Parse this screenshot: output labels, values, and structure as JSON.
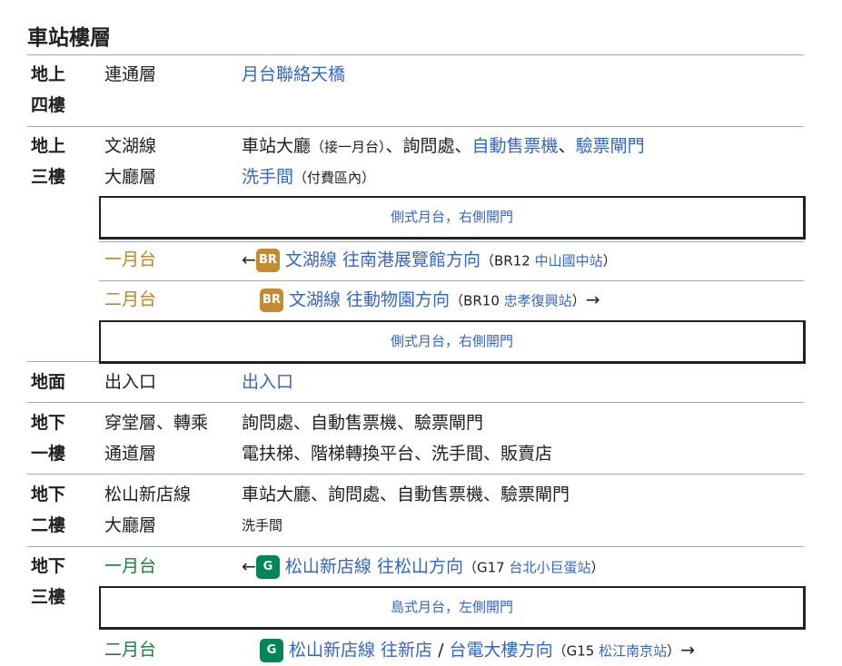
{
  "title": "車站樓層",
  "colors": {
    "link": "#3366cc",
    "br_line": "#c48c31",
    "g_line": "#008659"
  },
  "floors": {
    "l4": {
      "floor_a": "地上",
      "floor_b": "四樓",
      "level": "連通層",
      "facility": "月台聯絡天橋"
    },
    "l3": {
      "floor_a": "地上",
      "floor_b": "三樓",
      "level_a": "文湖線",
      "level_b": "大廳層",
      "f1_a": "車站大廳",
      "f1_b": "（接一月台）",
      "f1_c": "、詢問處、",
      "f1_d": "自動售票機",
      "f1_e": "、",
      "f1_f": "驗票閘門",
      "f2_a": "洗手間",
      "f2_b": "（付費區內）",
      "box_top": "側式月台，右側開門",
      "p1_label": "一月台",
      "p1_arrow": "←",
      "p1_badge": "BR",
      "p1_line": "文湖線",
      "p1_dir": " 往南港展覽館方向",
      "p1_code_open": "（BR12 ",
      "p1_station": "中山國中站",
      "p1_code_close": "）",
      "p2_label": "二月台",
      "p2_badge": "BR",
      "p2_line": "文湖線",
      "p2_dir": " 往動物園方向",
      "p2_code_open": "（BR10 ",
      "p2_station": "忠孝復興站",
      "p2_code_close": "）",
      "p2_arrow": "→",
      "box_bottom": "側式月台，右側開門"
    },
    "gf": {
      "floor": "地面",
      "level": "出入口",
      "facility": "出入口"
    },
    "b1": {
      "floor_a": "地下",
      "floor_b": "一樓",
      "level_a": "穿堂層、轉乘",
      "level_b": "通道層",
      "f1": "詢問處、自動售票機、驗票閘門",
      "f2": "電扶梯、階梯轉換平台、洗手間、販賣店"
    },
    "b2": {
      "floor_a": "地下",
      "floor_b": "二樓",
      "level_a": "松山新店線",
      "level_b": "大廳層",
      "f1": "車站大廳、詢問處、自動售票機、驗票閘門",
      "f2": "洗手間"
    },
    "b3": {
      "floor_a": "地下",
      "floor_b": "三樓",
      "p1_label": "一月台",
      "p1_arrow": "←",
      "p1_badge": "G",
      "p1_line": "松山新店線",
      "p1_dir": " 往松山方向",
      "p1_code_open": "（G17 ",
      "p1_station": "台北小巨蛋站",
      "p1_code_close": "）",
      "box": "島式月台，左側開門",
      "p2_label": "二月台",
      "p2_badge": "G",
      "p2_line": "松山新店線",
      "p2_dir_a": " 往新店",
      "p2_sep": " / ",
      "p2_dir_b": "台電大樓",
      "p2_dir_c": "方向",
      "p2_code_open": "（G15 ",
      "p2_station": "松江南京站",
      "p2_code_close": "）",
      "p2_arrow": "→"
    }
  }
}
